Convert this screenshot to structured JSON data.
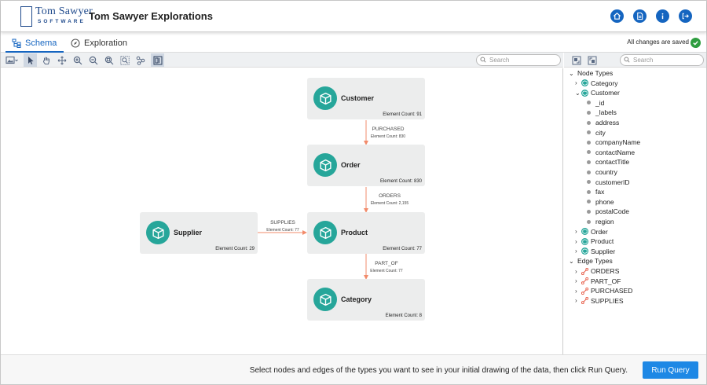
{
  "app": {
    "title": "Tom Sawyer Explorations",
    "logo_name": "Tom Sawyer",
    "logo_sub": "SOFTWARE"
  },
  "header_buttons": [
    "home-icon",
    "document-icon",
    "info-icon",
    "logout-icon"
  ],
  "tabs": [
    {
      "label": "Schema",
      "active": true,
      "icon": "schema-icon"
    },
    {
      "label": "Exploration",
      "active": false,
      "icon": "compass-icon"
    }
  ],
  "save_status": "All changes are saved",
  "canvas_toolbar": {
    "tools": [
      "image-export-icon",
      "select-pointer-icon",
      "pan-hand-icon",
      "move-icon",
      "zoom-in-icon",
      "zoom-out-icon",
      "zoom-fit-icon",
      "zoom-selection-icon",
      "nodes-layout-icon",
      "overview-icon"
    ],
    "search_placeholder": "Search"
  },
  "graph": {
    "nodes": [
      {
        "id": "customer",
        "label": "Customer",
        "count_text": "Element Count: 91"
      },
      {
        "id": "order",
        "label": "Order",
        "count_text": "Element Count: 830"
      },
      {
        "id": "supplier",
        "label": "Supplier",
        "count_text": "Element Count: 29"
      },
      {
        "id": "product",
        "label": "Product",
        "count_text": "Element Count: 77"
      },
      {
        "id": "category",
        "label": "Category",
        "count_text": "Element Count: 8"
      }
    ],
    "edges": [
      {
        "label": "PURCHASED",
        "count_text": "Element Count: 830"
      },
      {
        "label": "ORDERS",
        "count_text": "Element Count: 2,155"
      },
      {
        "label": "SUPPLIES",
        "count_text": "Element Count: 77"
      },
      {
        "label": "PART_OF",
        "count_text": "Element Count: 77"
      }
    ],
    "colors": {
      "node_icon": "#26a69a",
      "edge": "#f28b6b",
      "node_bg": "#eceded"
    }
  },
  "right_panel": {
    "tools": [
      "expand-all-icon",
      "collapse-all-icon"
    ],
    "search_placeholder": "Search",
    "tree": {
      "node_types_label": "Node Types",
      "node_types": [
        "Category",
        "Customer",
        "Order",
        "Product",
        "Supplier"
      ],
      "customer_properties": [
        "_id",
        "_labels",
        "address",
        "city",
        "companyName",
        "contactName",
        "contactTitle",
        "country",
        "customerID",
        "fax",
        "phone",
        "postalCode",
        "region"
      ],
      "edge_types_label": "Edge Types",
      "edge_types": [
        "ORDERS",
        "PART_OF",
        "PURCHASED",
        "SUPPLIES"
      ]
    }
  },
  "footer": {
    "message": "Select nodes and edges of the types you want to see in your initial drawing of the data, then click Run Query.",
    "run_query_label": "Run Query"
  }
}
